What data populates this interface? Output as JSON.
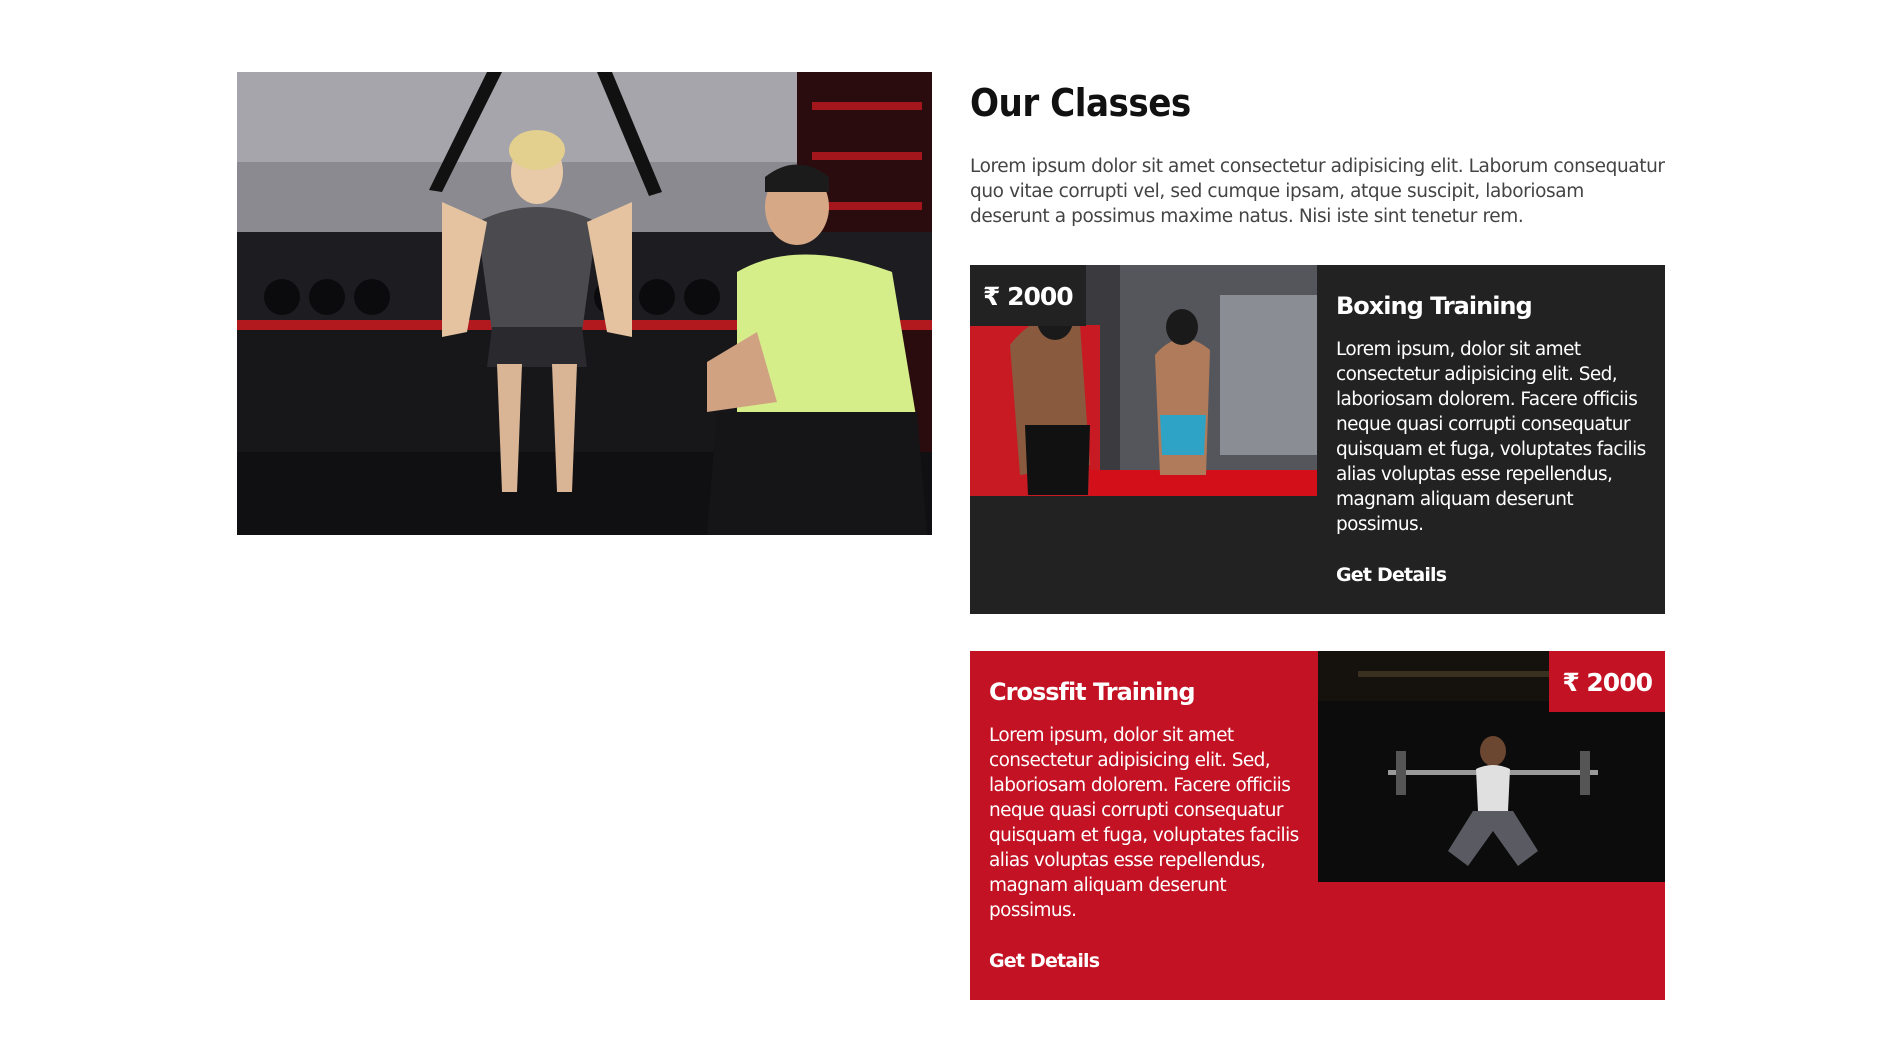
{
  "section": {
    "title": "Our Classes",
    "intro": "Lorem ipsum dolor sit amet consectetur adipisicing elit. Laborum consequatur quo vitae corrupti vel, sed cumque ipsam, atque suscipit, laboriosam deserunt a possimus maxime natus. Nisi iste sint tenetur rem."
  },
  "classes": [
    {
      "title": "Boxing Training",
      "price": "₹ 2000",
      "description": "Lorem ipsum, dolor sit amet consectetur adipisicing elit. Sed, laboriosam dolorem. Facere officiis neque quasi corrupti consequatur quisquam et fuga, voluptates facilis alias voluptas esse repellendus, magnam aliquam deserunt possimus.",
      "link_label": "Get Details",
      "background": "#222222"
    },
    {
      "title": "Crossfit Training",
      "price": "₹ 2000",
      "description": "Lorem ipsum, dolor sit amet consectetur adipisicing elit. Sed, laboriosam dolorem. Facere officiis neque quasi corrupti consequatur quisquam et fuga, voluptates facilis alias voluptas esse repellendus, magnam aliquam deserunt possimus.",
      "link_label": "Get Details",
      "background": "#c31224"
    }
  ],
  "colors": {
    "accent": "#c31224",
    "dark": "#222222",
    "heading": "#111111",
    "body_text": "#444444"
  }
}
